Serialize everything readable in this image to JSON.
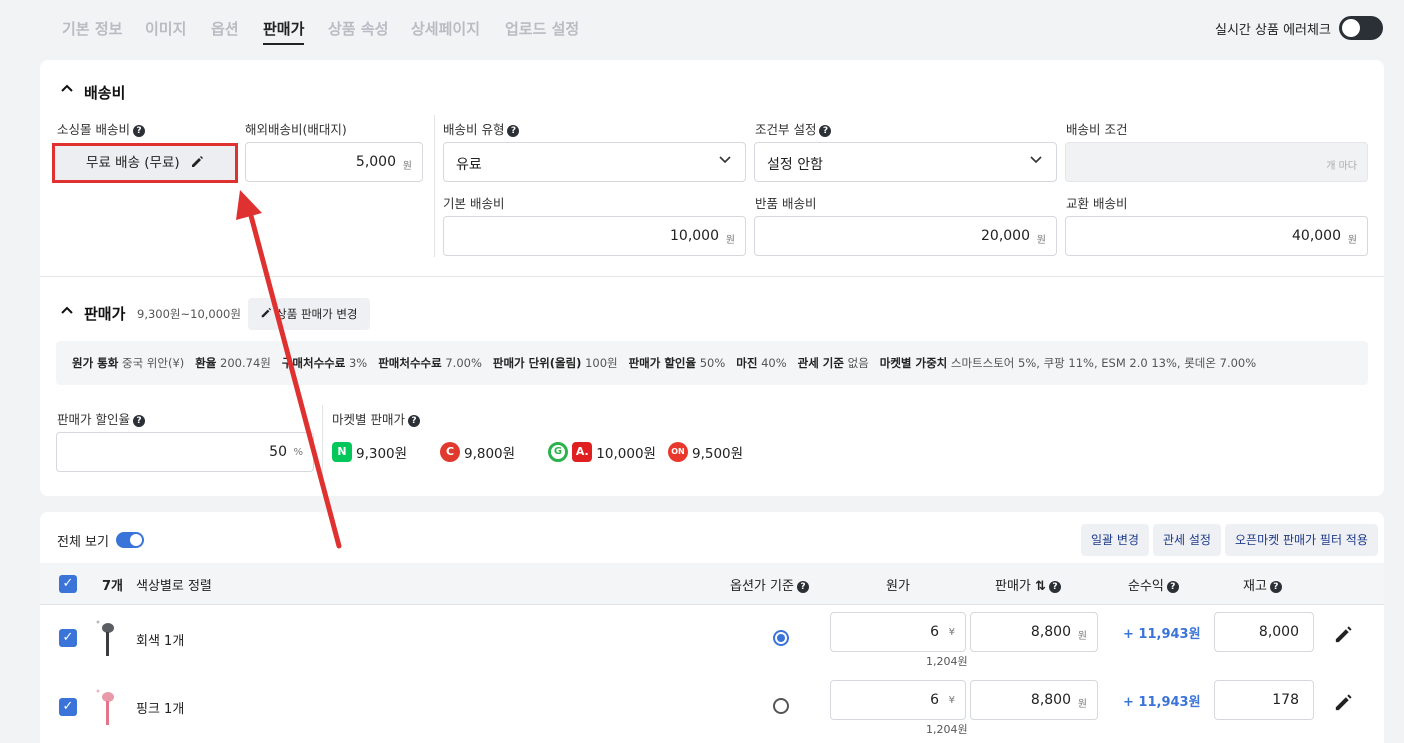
{
  "tabs": [
    "기본 정보",
    "이미지",
    "옵션",
    "판매가",
    "상품 속성",
    "상세페이지",
    "업로드 설정"
  ],
  "active_tab": "판매가",
  "realtime_check_label": "실시간 상품 에러체크",
  "shipping": {
    "title": "배송비",
    "small_item_label": "소싱몰 배송비",
    "small_item_button": "무료 배송 (무료)",
    "overseas_label": "해외배송비(배대지)",
    "overseas_value": "5,000",
    "type_label": "배송비 유형",
    "type_value": "유료",
    "cond_label": "조건부 설정",
    "cond_value": "설정 안함",
    "cond_amount_label": "배송비 조건",
    "cond_amount_unit": "개 마다",
    "base_label": "기본 배송비",
    "base_value": "10,000",
    "return_label": "반품 배송비",
    "return_value": "20,000",
    "exchange_label": "교환 배송비",
    "exchange_value": "40,000",
    "unit": "원"
  },
  "price": {
    "title": "판매가",
    "range": "9,300원~10,000원",
    "change_button": "상품 판매가 변경",
    "info": [
      {
        "k": "원가 통화",
        "v": "중국 위안(¥)"
      },
      {
        "k": "환율",
        "v": "200.74원"
      },
      {
        "k": "구매처수수료",
        "v": "3%"
      },
      {
        "k": "판매처수수료",
        "v": "7.00%"
      },
      {
        "k": "판매가 단위(올림)",
        "v": "100원"
      },
      {
        "k": "판매가 할인율",
        "v": "50%"
      },
      {
        "k": "마진",
        "v": "40%"
      },
      {
        "k": "관세 기준",
        "v": "없음"
      },
      {
        "k": "마켓별 가중치",
        "v": "스마트스토어 5%, 쿠팡 11%, ESM 2.0 13%, 롯데온 7.00%"
      }
    ],
    "discount_label": "판매가 할인율",
    "discount_value": "50",
    "discount_unit": "%",
    "market_label": "마켓별 판매가",
    "markets": [
      {
        "icon": "naver-icon",
        "letter": "N",
        "color": "#03c75a",
        "price": "9,300원"
      },
      {
        "icon": "coupang-icon",
        "letter": "C",
        "color": "#e03a2f",
        "price": "9,800원"
      },
      {
        "icon": "gmarket-icon",
        "letter": "G",
        "color": "#2bb24c",
        "price": ""
      },
      {
        "icon": "auction-icon",
        "letter": "A.",
        "color": "#e02020",
        "price": "10,000원"
      },
      {
        "icon": "lotteon-icon",
        "letter": "ON",
        "color": "#e8382b",
        "price": "9,500원"
      }
    ]
  },
  "table": {
    "view_all": "전체 보기",
    "buttons": [
      "일괄 변경",
      "관세 설정",
      "오픈마켓 판매가 필터 적용"
    ],
    "count": "7개",
    "sort": "색상별로 정렬",
    "headers": {
      "option_basis": "옵션가 기준",
      "cost": "원가",
      "sale": "판매가",
      "profit": "순수익",
      "stock": "재고"
    },
    "rows": [
      {
        "name": "회색 1개",
        "cost": "6",
        "cost_unit": "¥",
        "cost_krw": "1,204원",
        "sale": "8,800",
        "sale_unit": "원",
        "profit": "+ 11,943원",
        "stock": "8,000"
      },
      {
        "name": "핑크 1개",
        "cost": "6",
        "cost_unit": "¥",
        "cost_krw": "1,204원",
        "sale": "8,800",
        "sale_unit": "원",
        "profit": "+ 11,943원",
        "stock": "178"
      }
    ]
  },
  "colors": {
    "accent": "#3b74d8",
    "highlight": "#e03131"
  }
}
